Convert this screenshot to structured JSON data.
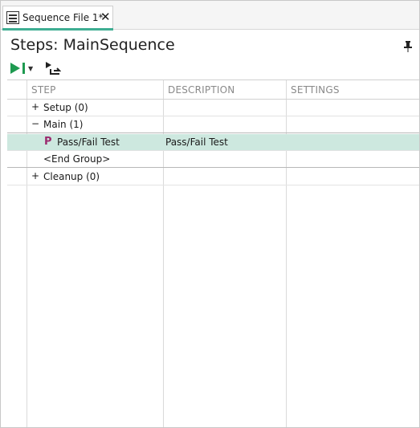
{
  "tab": {
    "label": "Sequence File 1*",
    "close": "✕"
  },
  "panel": {
    "title": "Steps: MainSequence"
  },
  "toolbar": {
    "run_dropdown": "▼"
  },
  "columns": [
    "STEP",
    "DESCRIPTION",
    "SETTINGS"
  ],
  "rows": [
    {
      "expander": "+",
      "step": "Setup (0)",
      "description": "",
      "settings": ""
    },
    {
      "expander": "−",
      "step": "Main (1)",
      "description": "",
      "settings": ""
    },
    {
      "icon": "P",
      "step": "Pass/Fail Test",
      "description": "Pass/Fail Test",
      "settings": ""
    },
    {
      "step": "<End Group>",
      "description": "",
      "settings": ""
    },
    {
      "expander": "+",
      "step": "Cleanup (0)",
      "description": "",
      "settings": ""
    }
  ],
  "colors": {
    "accent": "#3fae93",
    "selected_row": "#cde8df",
    "step_icon": "#9b2a6e",
    "run_green": "#1e9a50"
  }
}
